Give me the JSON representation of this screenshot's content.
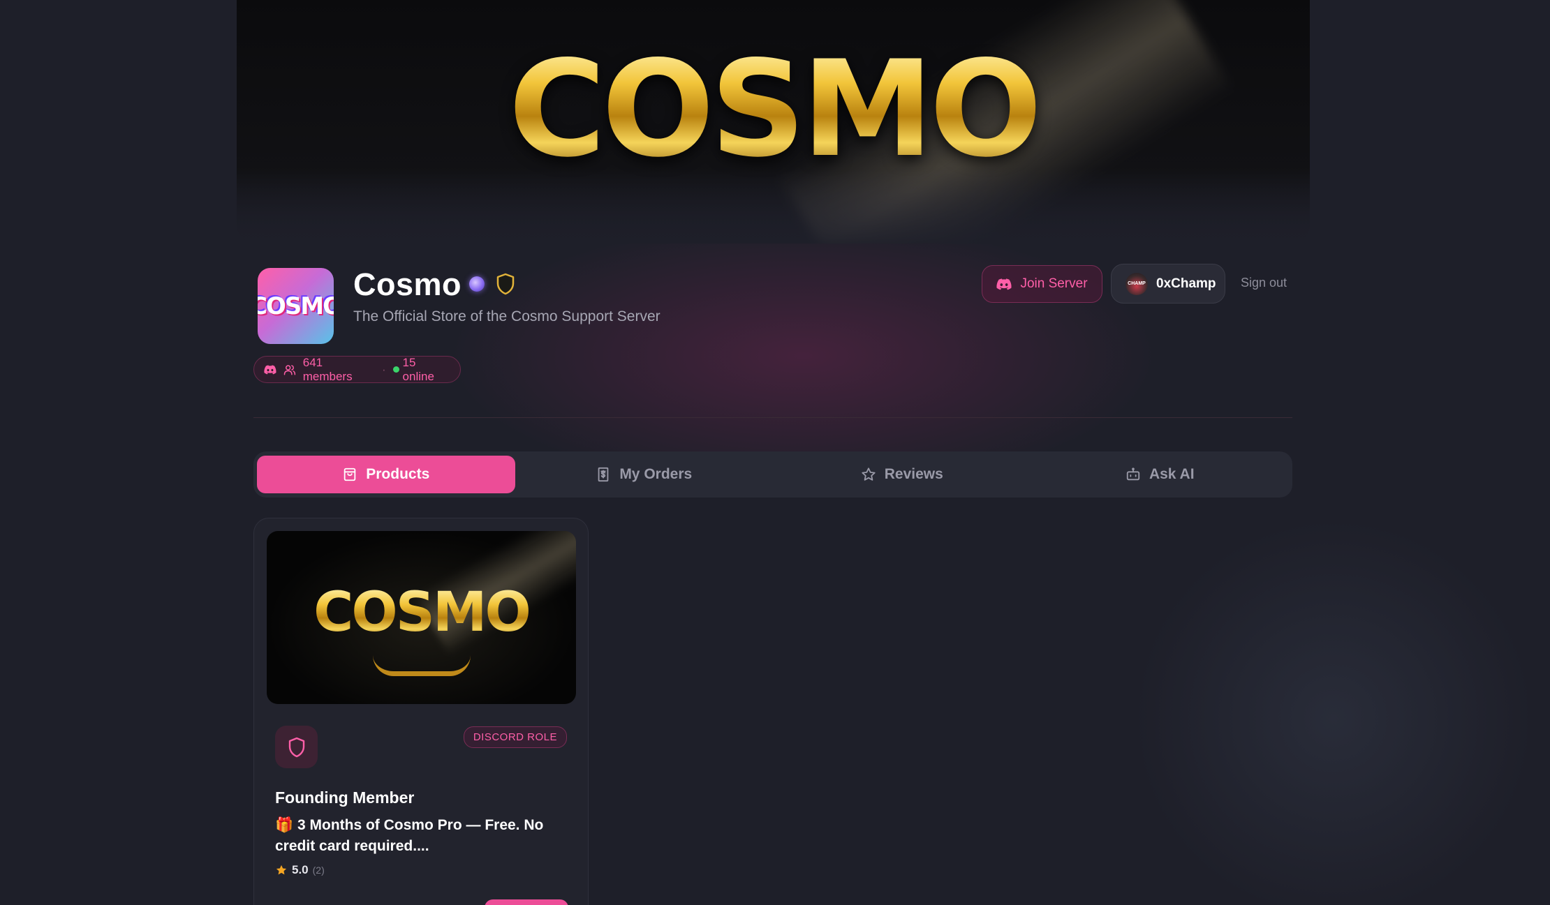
{
  "banner": {
    "logo_text": "COSMO"
  },
  "server": {
    "icon_text": "COSMO",
    "name": "Cosmo",
    "description": "The Official Store of the Cosmo Support Server",
    "members": "641 members",
    "online": "15 online",
    "separator": "·"
  },
  "header": {
    "join_label": "Join Server",
    "user_name": "0xChamp",
    "avatar_text": "CHAMP",
    "signout_label": "Sign out"
  },
  "tabs": [
    {
      "label": "Products",
      "icon": "shopping-bag-icon",
      "active": true
    },
    {
      "label": "My Orders",
      "icon": "receipt-icon",
      "active": false
    },
    {
      "label": "Reviews",
      "icon": "star-icon",
      "active": false
    },
    {
      "label": "Ask AI",
      "icon": "bot-icon",
      "active": false
    }
  ],
  "products": [
    {
      "image_text": "COSMO",
      "tag": "DISCORD ROLE",
      "title": "Founding Member",
      "description": "🎁 3 Months of Cosmo Pro — Free. No credit card required....",
      "rating": "5.0",
      "rating_count": "(2)"
    }
  ],
  "colors": {
    "accent": "#ec4d97",
    "accent_text": "#ff5fa8",
    "background": "#1e1f29",
    "online": "#3bd46a",
    "gold": "#f2c53a"
  }
}
